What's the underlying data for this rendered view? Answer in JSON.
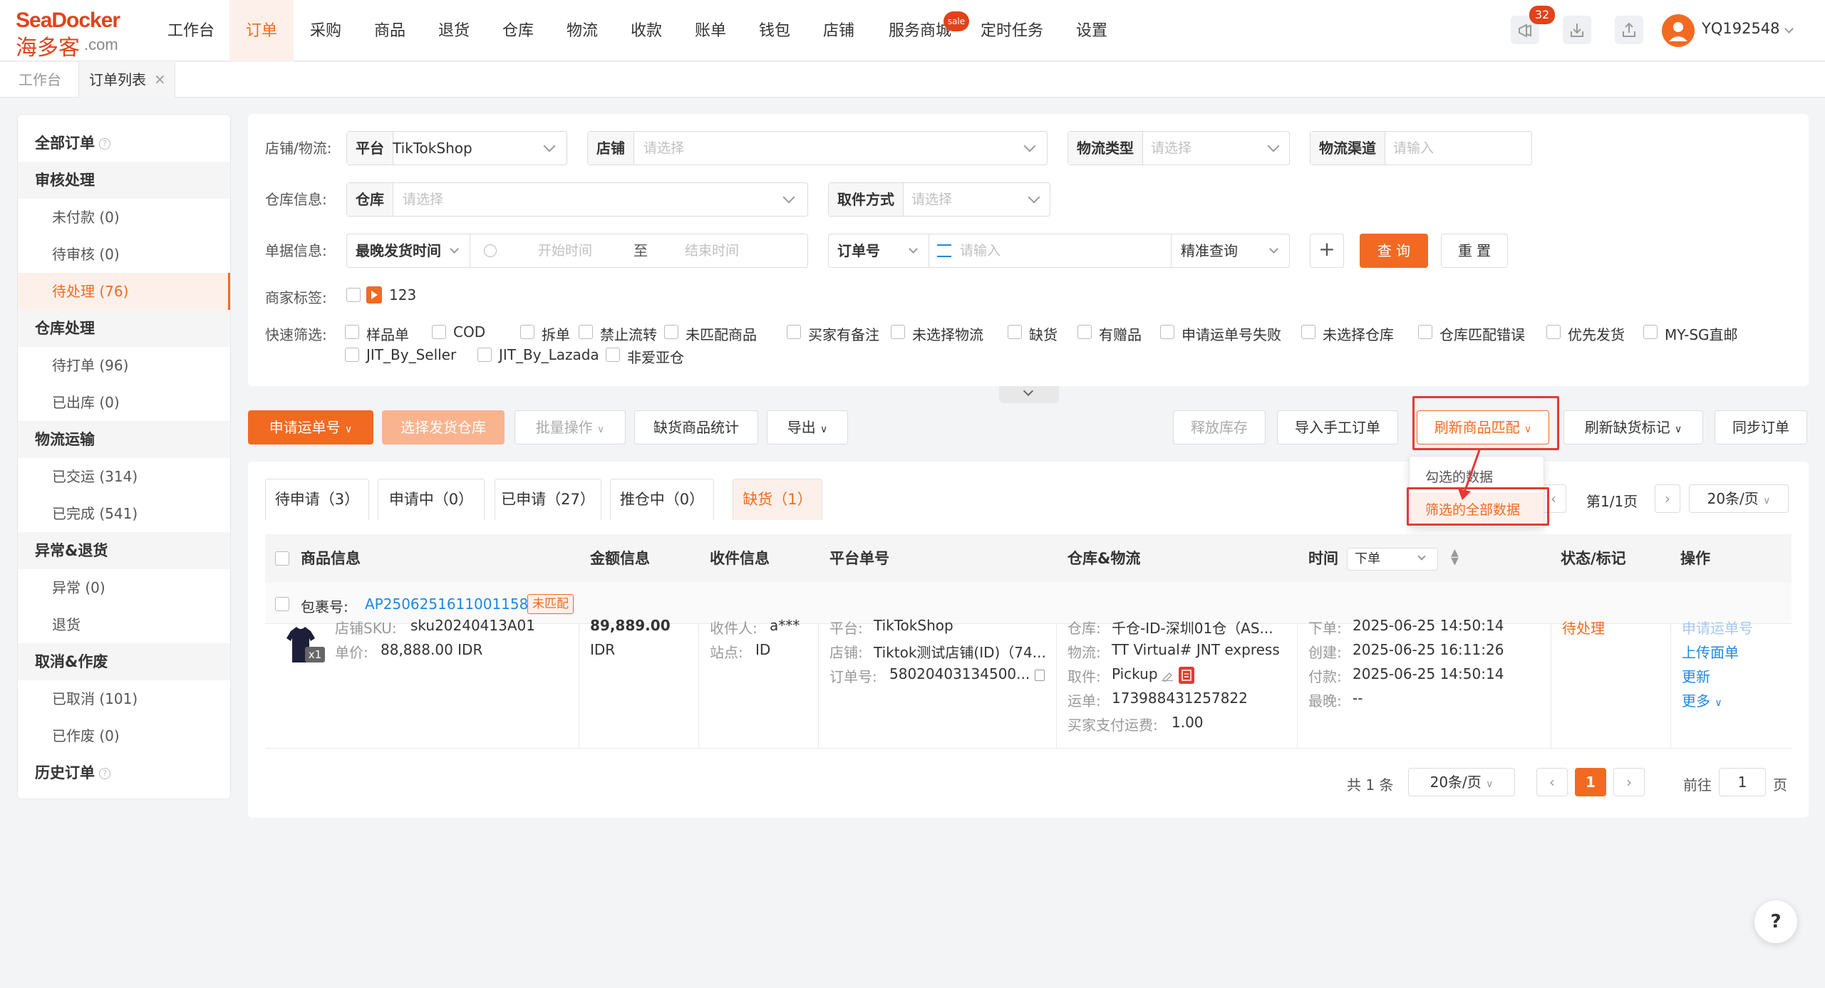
{
  "brand": {
    "logo_en": "SeaDocker",
    "logo_cn": "海多客",
    "logo_suffix": ".com"
  },
  "nav": [
    "工作台",
    "订单",
    "采购",
    "商品",
    "退货",
    "仓库",
    "物流",
    "收款",
    "账单",
    "钱包",
    "店铺",
    "服务商城",
    "定时任务",
    "设置"
  ],
  "nav_active": "订单",
  "service_badge": "sale",
  "notify_count": "32",
  "user": {
    "name": "YQ192548"
  },
  "tabs": {
    "home": "工作台",
    "current": "订单列表",
    "close": "×"
  },
  "sidebar": {
    "all_orders": "全部订单",
    "groups": [
      {
        "title": "审核处理",
        "items": [
          "未付款 (0)",
          "待审核 (0)",
          "待处理 (76)"
        ]
      },
      {
        "title": "仓库处理",
        "items": [
          "待打单 (96)",
          "已出库 (0)"
        ]
      },
      {
        "title": "物流运输",
        "items": [
          "已交运 (314)",
          "已完成 (541)"
        ]
      },
      {
        "title": "异常&退货",
        "items": [
          "异常 (0)",
          "退货"
        ]
      },
      {
        "title": "取消&作废",
        "items": [
          "已取消 (101)",
          "已作废 (0)"
        ]
      }
    ],
    "history": "历史订单"
  },
  "filter": {
    "shop_label": "店铺/物流:",
    "platform_pre": "平台",
    "platform_val": "TikTokShop",
    "shop_pre": "店铺",
    "shop_ph": "请选择",
    "ltype_pre": "物流类型",
    "ltype_ph": "请选择",
    "lchan_pre": "物流渠道",
    "lchan_ph": "请输入",
    "wh_label": "仓库信息:",
    "wh_pre": "仓库",
    "wh_ph": "请选择",
    "pick_pre": "取件方式",
    "pick_ph": "请选择",
    "doc_label": "单据信息:",
    "time_sel": "最晚发货时间",
    "start_ph": "开始时间",
    "to": "至",
    "end_ph": "结束时间",
    "orderno_sel": "订单号",
    "orderno_ph": "请输入",
    "exact": "精准查询",
    "plus": "+",
    "query": "查 询",
    "reset": "重 置",
    "tag_label": "商家标签:",
    "tag_val": "123",
    "quick_label": "快速筛选:",
    "quick_row1": [
      "样品单",
      "COD",
      "拆单",
      "禁止流转",
      "未匹配商品",
      "买家有备注",
      "未选择物流",
      "缺货",
      "有赠品",
      "申请运单号失败",
      "未选择仓库",
      "仓库匹配错误",
      "优先发货",
      "MY-SG直邮"
    ],
    "quick_row2": [
      "JIT_By_Seller",
      "JIT_By_Lazada",
      "非爱亚仓"
    ]
  },
  "actions": {
    "apply_no": "申请运单号",
    "select_wh": "选择发货仓库",
    "batch": "批量操作",
    "stock_stat": "缺货商品统计",
    "export": "导出",
    "release": "释放库存",
    "import": "导入手工订单",
    "refresh_match": "刷新商品匹配",
    "refresh_stock": "刷新缺货标记",
    "sync": "同步订单"
  },
  "dropdown": {
    "opt1": "勾选的数据",
    "opt2": "筛选的全部数据"
  },
  "subtabs": [
    "待申请（3）",
    "申请中（0）",
    "已申请（27）",
    "推仓中（0）",
    "缺货（1）"
  ],
  "pager_top": {
    "page": "第1/1页",
    "size": "20条/页"
  },
  "table": {
    "headers": [
      "商品信息",
      "金额信息",
      "收件信息",
      "平台单号",
      "仓库&物流",
      "时间",
      "状态/标记",
      "操作"
    ],
    "time_sel": "下单",
    "pkg_label": "包裹号:",
    "pkg_no": "AP2506251611001158",
    "pkg_tag": "未匹配",
    "row": {
      "sku_label": "店铺SKU:",
      "sku": "sku20240413A01",
      "price_label": "单价:",
      "price": "88,888.00 IDR",
      "qty": "x1",
      "amount": "89,889.00",
      "currency": "IDR",
      "recv_label": "收件人:",
      "recv": "a***",
      "site_label": "站点:",
      "site": "ID",
      "plat_label": "平台:",
      "plat": "TikTokShop",
      "shop_label": "店铺:",
      "shop": "Tiktok测试店铺(ID)（74...",
      "ord_label": "订单号:",
      "ord": "58020403134500...",
      "wh_label": "仓库:",
      "wh": "千仓-ID-深圳01仓（AS...",
      "log_label": "物流:",
      "log": "TT Virtual# JNT express",
      "pick_label": "取件:",
      "pick": "Pickup",
      "way_label": "运单:",
      "way": "173988431257822",
      "fee_label": "买家支付运费:",
      "fee": "1.00",
      "t1_label": "下单:",
      "t1": "2025-06-25 14:50:14",
      "t2_label": "创建:",
      "t2": "2025-06-25 16:11:26",
      "t3_label": "付款:",
      "t3": "2025-06-25 14:50:14",
      "t4_label": "最晚:",
      "t4": "--",
      "status": "待处理",
      "op1": "申请运单号",
      "op2": "上传面单",
      "op3": "更新",
      "op4": "更多"
    }
  },
  "pager": {
    "total": "共 1 条",
    "size": "20条/页",
    "page": "1",
    "goto": "前往",
    "goto_val": "1",
    "page_unit": "页"
  },
  "help": "?",
  "colors": {
    "accent": "#f26a21",
    "link": "#1e88e5",
    "highlight": "#e53935"
  }
}
